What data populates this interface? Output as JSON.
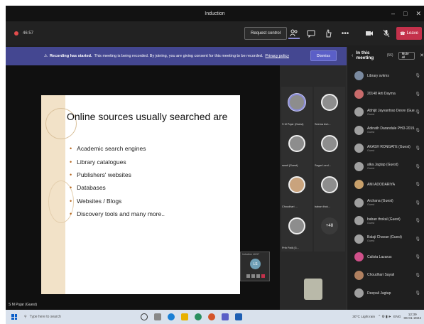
{
  "window": {
    "title": "Induction",
    "controls": [
      "–",
      "□",
      "✕"
    ]
  },
  "toolbar": {
    "timer": "46:57",
    "request_control": "Request control",
    "icons": [
      "people-icon",
      "chat-icon",
      "reactions-icon",
      "more-icon",
      "camera-icon",
      "mic-icon",
      "share-icon"
    ],
    "leave": "Leave"
  },
  "banner": {
    "title": "Recording has started.",
    "message": "This meeting is being recorded. By joining, you are giving consent for this meeting to be recorded.",
    "policy_link": "Privacy policy",
    "dismiss": "Dismiss"
  },
  "slide": {
    "title": "Online sources usually searched are",
    "bullets": [
      "Academic search engines",
      "Library catalogues",
      "Publishers' websites",
      "Databases",
      "Websites / Blogs",
      "Discovery tools and many more.."
    ]
  },
  "presenter_label": "S M Pujar (Guest)",
  "mini_window": {
    "header": "Induction 46:57",
    "initials": "LS"
  },
  "grid": [
    {
      "name": "S M Pujar (Guest)",
      "kind": "ring"
    },
    {
      "name": "Seema Avh...",
      "kind": "avatar"
    },
    {
      "name": "swati (Guest)",
      "kind": "avatar"
    },
    {
      "name": "Sagar Lond...",
      "kind": "avatar"
    },
    {
      "name": "Choudhari ...",
      "kind": "photo"
    },
    {
      "name": "baban thok...",
      "kind": "avatar"
    },
    {
      "name": "Prth Patil (G...",
      "kind": "avatar"
    },
    {
      "name": "",
      "kind": "more",
      "label": "+48"
    }
  ],
  "panel": {
    "title": "In this meeting",
    "count": "(56)",
    "mute_all": "Mute all",
    "participants": [
      {
        "name": "Library svkms",
        "role": "",
        "color": "#7a8aa0"
      },
      {
        "name": "20148 Arti Dayma",
        "role": "",
        "color": "#c86b6b"
      },
      {
        "name": "Abhijit Jayvantrao Desre (Gue...",
        "role": "Guest",
        "color": "#a0a0a0"
      },
      {
        "name": "Adinath Darandale PHD-2019...",
        "role": "Guest",
        "color": "#a0a0a0"
      },
      {
        "name": "AKASH RONGATE (Guest)",
        "role": "Guest",
        "color": "#a0a0a0"
      },
      {
        "name": "alka Jagtap (Guest)",
        "role": "Guest",
        "color": "#a0a0a0"
      },
      {
        "name": "AMI ADODARIYA",
        "role": "",
        "color": "#c8a06b"
      },
      {
        "name": "Archana (Guest)",
        "role": "Guest",
        "color": "#a0a0a0"
      },
      {
        "name": "baban thokal (Guest)",
        "role": "Guest",
        "color": "#a0a0a0"
      },
      {
        "name": "Balaji Chavan (Guest)",
        "role": "Guest",
        "color": "#a0a0a0"
      },
      {
        "name": "Calista Lazarus",
        "role": "",
        "color": "#d0508a"
      },
      {
        "name": "Choudhari Sayali",
        "role": "",
        "color": "#b08060"
      },
      {
        "name": "Deepali Jagtap",
        "role": "",
        "color": "#a0a0a0"
      }
    ]
  },
  "taskbar": {
    "search_placeholder": "Type here to search",
    "weather": "30°C Light rain",
    "lang": "ENG",
    "time": "12:39",
    "date": "06-01-2024"
  }
}
